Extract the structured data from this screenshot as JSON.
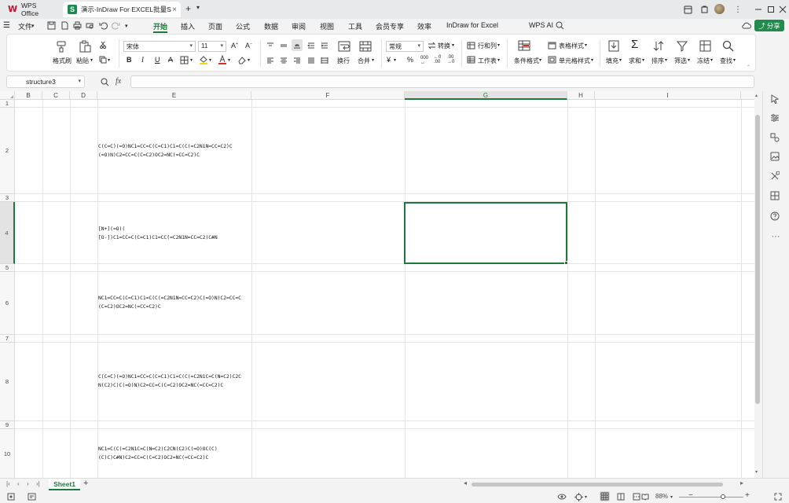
{
  "titlebar": {
    "tabs": [
      {
        "label": "WPS Office"
      },
      {
        "label": "演示-InDraw For EXCEL批量S"
      }
    ],
    "close_glyph": "×",
    "new_tab": "+"
  },
  "menubar": {
    "file": "文件",
    "items": [
      "开始",
      "插入",
      "页面",
      "公式",
      "数据",
      "审阅",
      "视图",
      "工具",
      "会员专享",
      "效率",
      "InDraw for Excel"
    ],
    "wps_ai": "WPS AI",
    "share": "分享"
  },
  "ribbon": {
    "format_painter": "格式刷",
    "paste": "粘贴",
    "font_name": "宋体",
    "font_size": "11",
    "wrap": "换行",
    "merge": "合并",
    "number_format": "常规",
    "convert": "转换",
    "row_col": "行和列",
    "worksheet": "工作表",
    "conditional_format": "条件格式",
    "table_style": "表格样式",
    "cell_style": "单元格样式",
    "fill": "填充",
    "sum": "求和",
    "sort": "排序",
    "filter": "筛选",
    "freeze": "冻结",
    "find": "查找",
    "bold": "B",
    "italic": "I",
    "underline": "U",
    "currency": "¥",
    "percent": "%",
    "font_color": "#d93025",
    "highlight_color": "#f5d90a"
  },
  "formula_bar": {
    "name_box": "structure3",
    "fx": "fx"
  },
  "grid": {
    "columns": [
      "B",
      "C",
      "D",
      "E",
      "F",
      "G",
      "H",
      "I"
    ],
    "selected_column": "G",
    "rows": [
      "1",
      "2",
      "3",
      "4",
      "5",
      "6",
      "7",
      "8",
      "9",
      "10"
    ],
    "selected_row": "4",
    "cells": [
      {
        "row": "2",
        "lines": [
          "C(C=C)(=O)NC1=CC=C(C=C1)C1=C(C(=C2N1N=CC=C2)C",
          "(=O)N)C2=CC=C(C=C2)OC2=NC(=CC=C2)C"
        ]
      },
      {
        "row": "4",
        "lines": [
          "[N+](=O)(",
          "[O-])C1=CC=C(C=C1)C1=CC(=C2N1N=CC=C2)C#N"
        ]
      },
      {
        "row": "6",
        "lines": [
          "NC1=CC=C(C=C1)C1=C(C(=C2N1N=CC=C2)C(=O)N)C2=CC=C",
          "(C=C2)OC2=NC(=CC=C2)C"
        ]
      },
      {
        "row": "8",
        "lines": [
          "C(C=C)(=O)NC1=CC=C(C=C1)C1=C(C(=C2N1C=C(N=C2)C2C",
          "N(C2)C)C(=O)N)C2=CC=C(C=C2)OC2=NC(=CC=C2)C"
        ]
      },
      {
        "row": "10",
        "lines": [
          "NC1=C(C(=C2N1C=C(N=C2)C2CN(C2)C(=O)OC(C)",
          "(C)C)C#N)C2=CC=C(C=C2)OC2=NC(=CC=C2)C"
        ]
      }
    ]
  },
  "sheets": {
    "active": "Sheet1",
    "add": "+"
  },
  "status": {
    "zoom": "88%"
  }
}
